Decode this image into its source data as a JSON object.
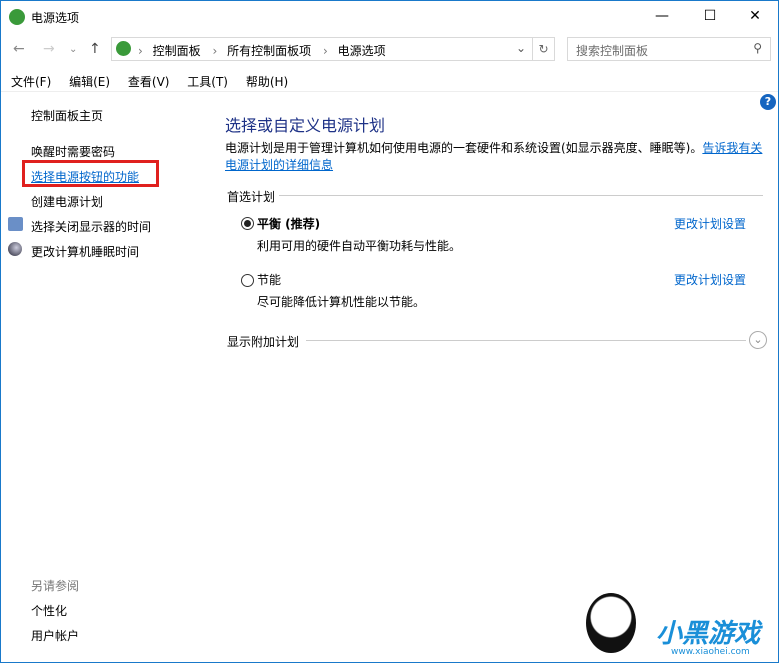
{
  "window": {
    "title": "电源选项",
    "minimize": "—",
    "maximize": "☐",
    "close": "✕"
  },
  "address": {
    "crumbs": [
      "控制面板",
      "所有控制面板项",
      "电源选项"
    ],
    "sep": "›",
    "search_placeholder": "搜索控制面板"
  },
  "menu": [
    "文件(F)",
    "编辑(E)",
    "查看(V)",
    "工具(T)",
    "帮助(H)"
  ],
  "sidebar": {
    "home": "控制面板主页",
    "items": [
      "唤醒时需要密码",
      "选择电源按钮的功能",
      "创建电源计划",
      "选择关闭显示器的时间",
      "更改计算机睡眠时间"
    ],
    "see_also": "另请参阅",
    "see_also_items": [
      "个性化",
      "用户帐户"
    ]
  },
  "main": {
    "title": "选择或自定义电源计划",
    "desc": "电源计划是用于管理计算机如何使用电源的一套硬件和系统设置(如显示器亮度、睡眠等)。",
    "desc_link1": "告诉我有关",
    "desc_link2": "电源计划的详细信息",
    "preferred": "首选计划",
    "plans": [
      {
        "name": "平衡 (推荐)",
        "desc": "利用可用的硬件自动平衡功耗与性能。",
        "link": "更改计划设置",
        "selected": true
      },
      {
        "name": "节能",
        "desc": "尽可能降低计算机性能以节能。",
        "link": "更改计划设置",
        "selected": false
      }
    ],
    "additional": "显示附加计划"
  },
  "watermark": {
    "text": "小黑游戏",
    "url": "www.xiaohei.com"
  },
  "colors": {
    "link": "#0066cc",
    "title": "#1e3287",
    "highlight": "#e0201e"
  }
}
